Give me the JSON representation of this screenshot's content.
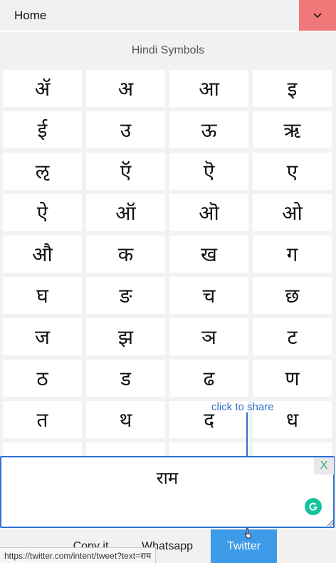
{
  "header": {
    "home_label": "Home",
    "menu_icon": "chevron-down-icon",
    "menu_color": "#f07878"
  },
  "section_title": "Hindi Symbols",
  "symbols": [
    "ॲ",
    "अ",
    "आ",
    "इ",
    "ई",
    "उ",
    "ऊ",
    "ऋ",
    "ऌ",
    "ऍ",
    "ऎ",
    "ए",
    "ऐ",
    "ऑ",
    "ऒ",
    "ओ",
    "औ",
    "क",
    "ख",
    "ग",
    "घ",
    "ङ",
    "च",
    "छ",
    "ज",
    "झ",
    "ञ",
    "ट",
    "ठ",
    "ड",
    "ढ",
    "ण",
    "त",
    "थ",
    "द",
    "ध",
    "",
    "",
    "",
    ""
  ],
  "annotation": {
    "share_hint": "click to share",
    "color": "#2f6fc9"
  },
  "editor": {
    "value": "राम",
    "clear_label": "X",
    "grammarly_icon": "grammarly-icon"
  },
  "footer": {
    "copy_label": "Copy it",
    "whatsapp_label": "Whatsapp",
    "twitter_label": "Twitter",
    "twitter_color": "#3d9be8"
  },
  "status_url": "https://twitter.com/intent/tweet?text=राम"
}
